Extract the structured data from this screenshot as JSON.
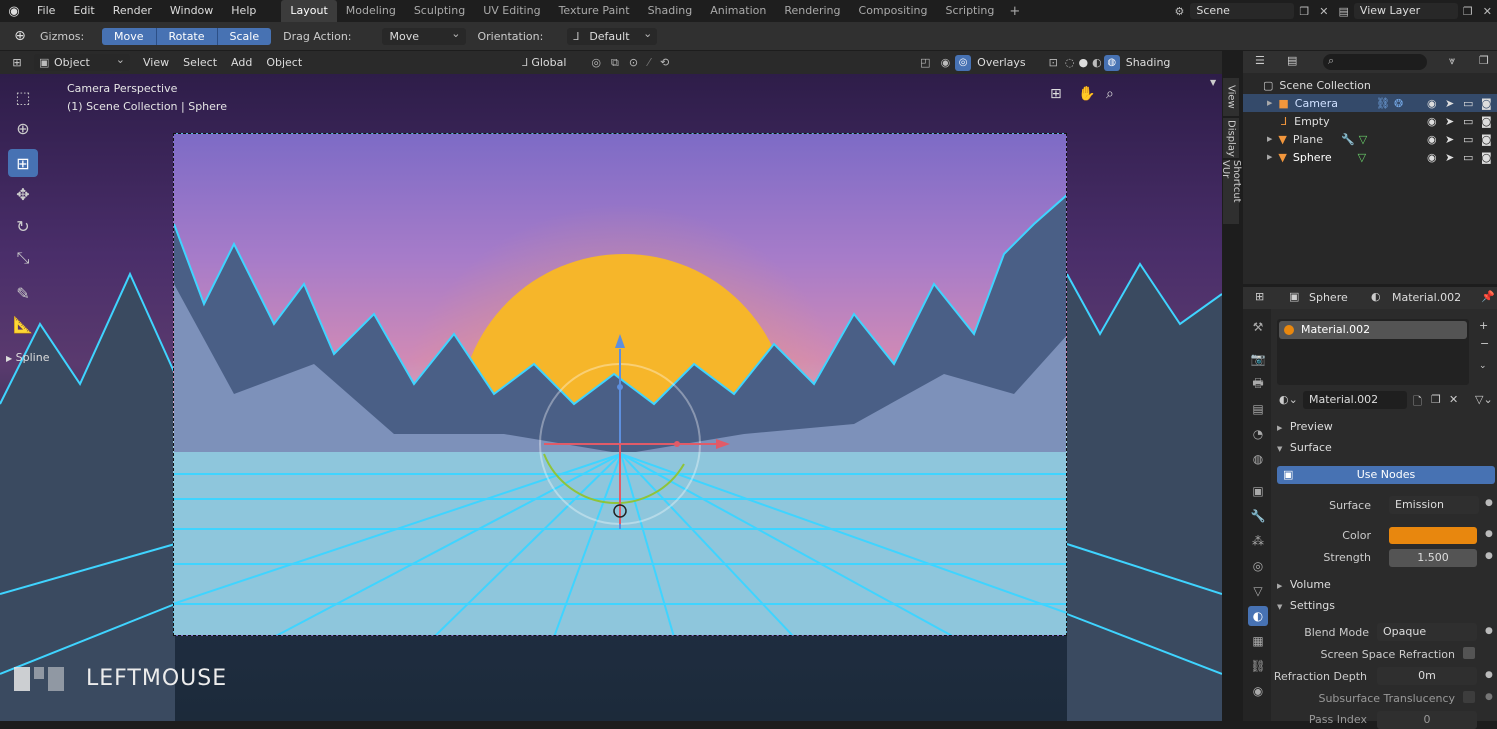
{
  "menu": {
    "items": [
      "File",
      "Edit",
      "Render",
      "Window",
      "Help"
    ]
  },
  "workspaces": [
    "Layout",
    "Modeling",
    "Sculpting",
    "UV Editing",
    "Texture Paint",
    "Shading",
    "Animation",
    "Rendering",
    "Compositing",
    "Scripting"
  ],
  "scene": {
    "label": "Scene",
    "view_layer": "View Layer"
  },
  "toolbar": {
    "gizmos": "Gizmos:",
    "move": "Move",
    "rotate": "Rotate",
    "scale": "Scale",
    "drag_action_label": "Drag Action:",
    "drag_action_value": "Move",
    "orientation_label": "Orientation:",
    "orientation_value": "Default"
  },
  "viewport_header": {
    "mode": "Object Mode",
    "view": "View",
    "select": "Select",
    "add": "Add",
    "object": "Object",
    "transform": "Global",
    "overlays": "Overlays",
    "shading": "Shading"
  },
  "viewport": {
    "camera_label": "Camera Perspective",
    "collection_label": "(1) Scene Collection | Sphere",
    "keypress": "LEFTMOUSE",
    "spline": "Spline"
  },
  "side_tabs": [
    "View",
    "Display",
    "Shortcut VUr"
  ],
  "outliner": {
    "root": "Scene Collection",
    "items": [
      {
        "name": "Camera",
        "selected": true
      },
      {
        "name": "Empty",
        "selected": false
      },
      {
        "name": "Plane",
        "selected": false
      },
      {
        "name": "Sphere",
        "selected": false
      }
    ]
  },
  "properties": {
    "object_name": "Sphere",
    "material_name": "Material.002",
    "slot_name": "Material.002",
    "datablock": "Material.002",
    "sections": {
      "preview": "Preview",
      "surface": "Surface",
      "volume": "Volume",
      "settings": "Settings"
    },
    "use_nodes": "Use Nodes",
    "surface_label": "Surface",
    "surface_value": "Emission",
    "color_label": "Color",
    "color_value": "#e8870e",
    "strength_label": "Strength",
    "strength_value": "1.500",
    "blend_mode_label": "Blend Mode",
    "blend_mode_value": "Opaque",
    "ssr_label": "Screen Space Refraction",
    "refraction_depth_label": "Refraction Depth",
    "refraction_depth_value": "0m",
    "sss_label": "Subsurface Translucency",
    "pass_index_label": "Pass Index",
    "pass_index_value": "0"
  },
  "colors": {
    "accent": "#4772b3",
    "sun": "#f6b62a",
    "grid": "#3fd4ff"
  }
}
